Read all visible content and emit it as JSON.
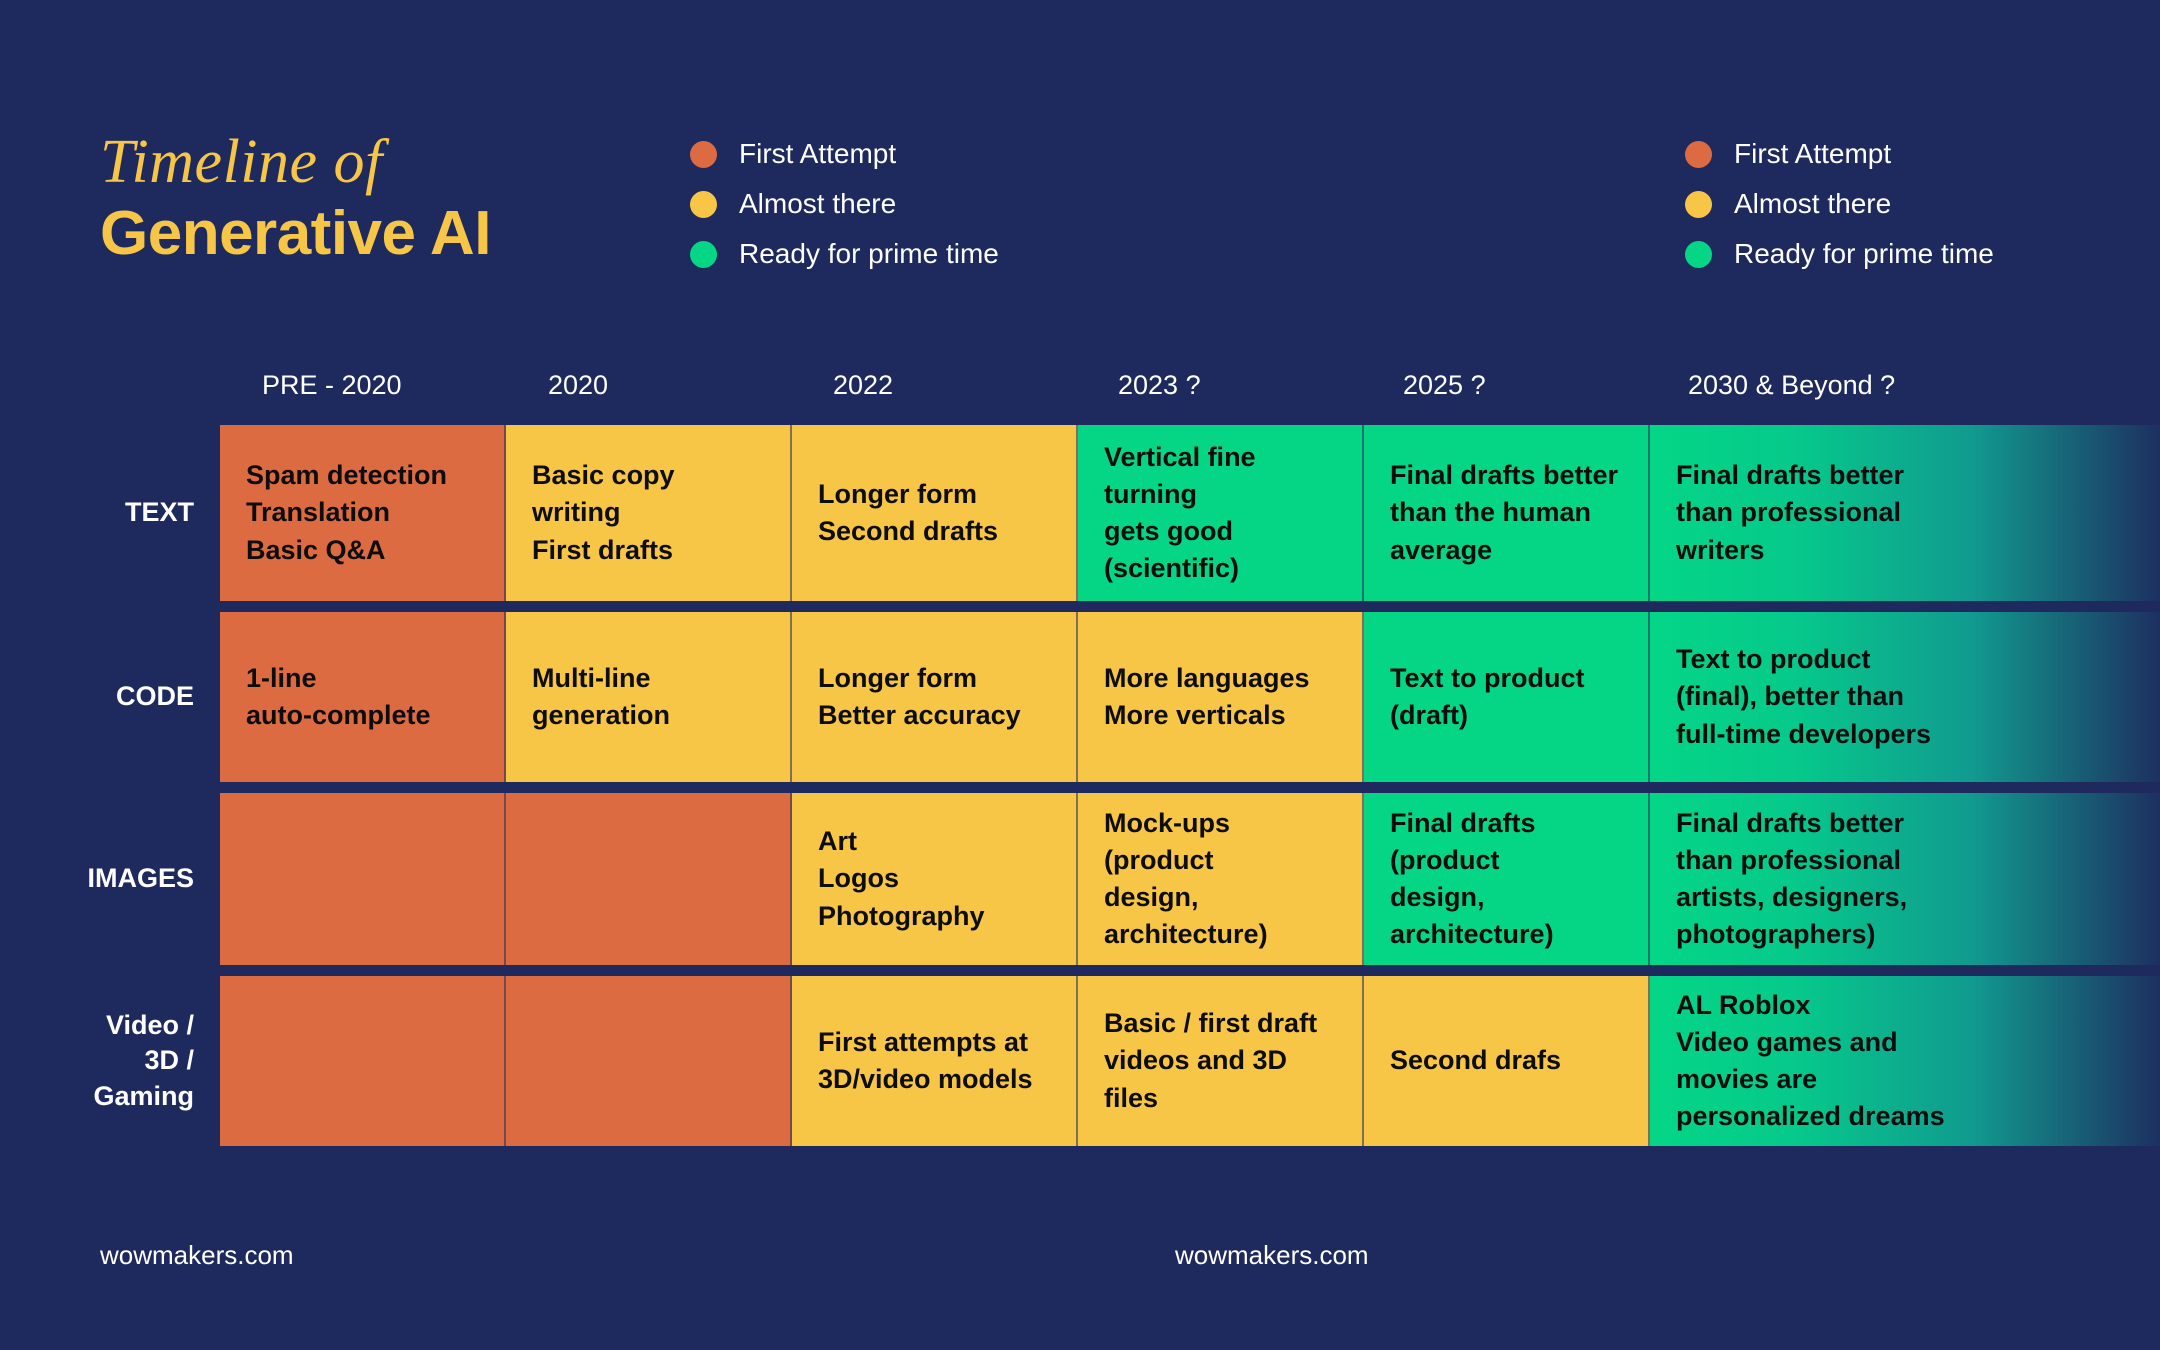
{
  "title": {
    "line1": "Timeline of",
    "line2": "Generative AI"
  },
  "colors": {
    "background": "#1e2a5e",
    "title_accent": "#f8c646",
    "first_attempt": "#dd6b42",
    "almost_there": "#f8c646",
    "ready_prime_time": "#04d686",
    "cell_text": "#0d0d0d",
    "label_text": "#ffffff"
  },
  "legend": {
    "items": [
      {
        "label": "First Attempt",
        "color": "#dd6b42"
      },
      {
        "label": "Almost there",
        "color": "#f8c646"
      },
      {
        "label": "Ready for prime time",
        "color": "#04d686"
      }
    ]
  },
  "columns": [
    "PRE - 2020",
    "2020",
    "2022",
    "2023 ?",
    "2025 ?",
    "2030 & Beyond ?"
  ],
  "rows": [
    {
      "label": "TEXT",
      "cells": [
        {
          "status": "first_attempt",
          "text": "Spam detection\nTranslation\nBasic Q&A"
        },
        {
          "status": "almost_there",
          "text": "Basic copy writing\nFirst drafts"
        },
        {
          "status": "almost_there",
          "text": "Longer form\nSecond drafts"
        },
        {
          "status": "ready_prime_time",
          "text": "Vertical fine turning\ngets good\n(scientific)"
        },
        {
          "status": "ready_prime_time",
          "text": "Final drafts better\nthan the human\naverage"
        },
        {
          "status": "ready_prime_time",
          "text": "Final drafts better\nthan professional\nwriters"
        }
      ]
    },
    {
      "label": "CODE",
      "cells": [
        {
          "status": "first_attempt",
          "text": "1-line\nauto-complete"
        },
        {
          "status": "almost_there",
          "text": "Multi-line\ngeneration"
        },
        {
          "status": "almost_there",
          "text": "Longer form\nBetter accuracy"
        },
        {
          "status": "almost_there",
          "text": "More languages\nMore verticals"
        },
        {
          "status": "ready_prime_time",
          "text": "Text to product\n(draft)"
        },
        {
          "status": "ready_prime_time",
          "text": "Text to product\n(final), better than\nfull-time developers"
        }
      ]
    },
    {
      "label": "IMAGES",
      "cells": [
        {
          "status": "first_attempt",
          "text": ""
        },
        {
          "status": "first_attempt",
          "text": ""
        },
        {
          "status": "almost_there",
          "text": "Art\nLogos\nPhotography"
        },
        {
          "status": "almost_there",
          "text": "Mock-ups (product\ndesign, architecture)"
        },
        {
          "status": "ready_prime_time",
          "text": "Final drafts (product\ndesign, architecture)"
        },
        {
          "status": "ready_prime_time",
          "text": "Final drafts better\nthan professional\nartists, designers,\nphotographers)"
        }
      ]
    },
    {
      "label": "Video /\n3D /\nGaming",
      "cells": [
        {
          "status": "first_attempt",
          "text": ""
        },
        {
          "status": "first_attempt",
          "text": ""
        },
        {
          "status": "almost_there",
          "text": "First attempts at\n3D/video models"
        },
        {
          "status": "almost_there",
          "text": "Basic / first draft\nvideos and 3D files"
        },
        {
          "status": "almost_there",
          "text": "Second drafs"
        },
        {
          "status": "ready_prime_time",
          "text": "AL Roblox\nVideo games and\nmovies are\npersonalized dreams"
        }
      ]
    }
  ],
  "footer": {
    "left": "wowmakers.com",
    "center": "wowmakers.com"
  }
}
